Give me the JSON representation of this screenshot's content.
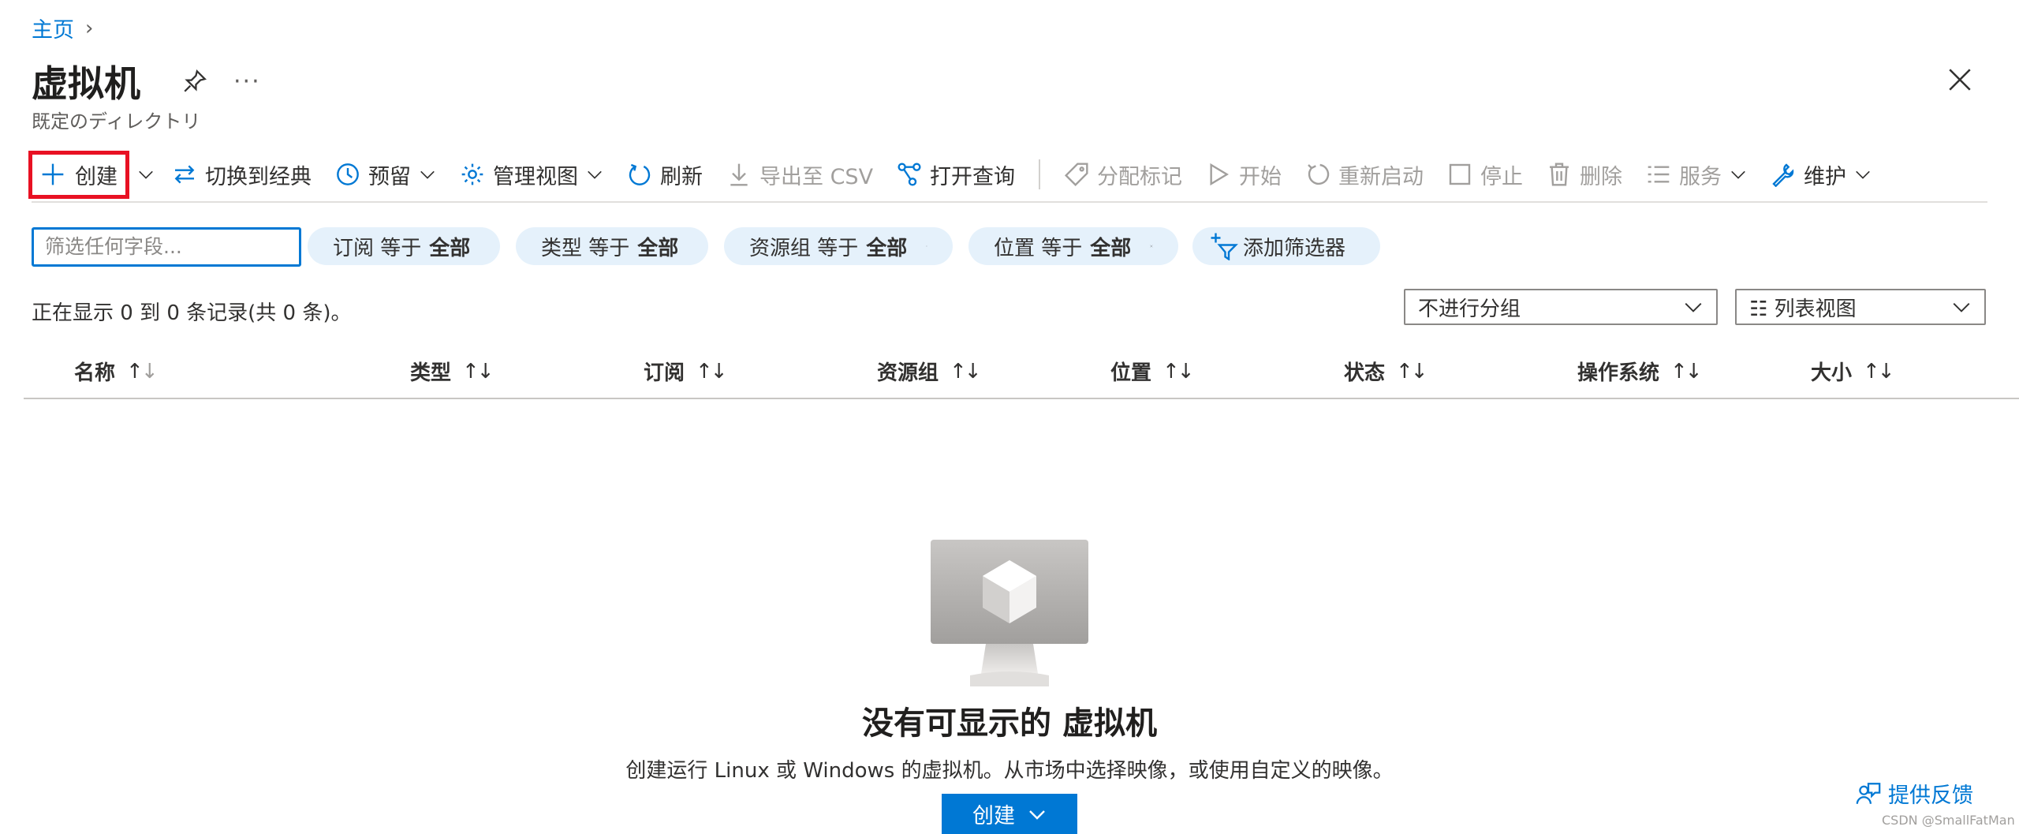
{
  "breadcrumb": {
    "home": "主页"
  },
  "header": {
    "title": "虚拟机",
    "subtitle": "既定のディレクトリ",
    "more": "···"
  },
  "toolbar": {
    "create": "创建",
    "switch_classic": "切换到经典",
    "reserve": "预留",
    "manage_view": "管理视图",
    "refresh": "刷新",
    "export_csv": "导出至 CSV",
    "open_query": "打开查询",
    "assign_tags": "分配标记",
    "start": "开始",
    "restart": "重新启动",
    "stop": "停止",
    "delete": "删除",
    "services": "服务",
    "maintain": "维护"
  },
  "filters": {
    "search_placeholder": "筛选任何字段...",
    "pills": [
      {
        "label": "订阅 等于",
        "value": "全部"
      },
      {
        "label": "类型 等于",
        "value": "全部"
      },
      {
        "label": "资源组 等于",
        "value": "全部"
      },
      {
        "label": "位置 等于",
        "value": "全部"
      }
    ],
    "add_filter": "添加筛选器"
  },
  "records": {
    "count_text": "正在显示 0 到 0 条记录(共 0 条)。",
    "group_select": "不进行分组",
    "view_select": "☷ 列表视图"
  },
  "table": {
    "columns": [
      "名称",
      "类型",
      "订阅",
      "资源组",
      "位置",
      "状态",
      "操作系统",
      "大小"
    ]
  },
  "empty": {
    "title": "没有可显示的 虚拟机",
    "description": "创建运行 Linux 或 Windows 的虚拟机。从市场中选择映像，或使用自定义的映像。",
    "create_button": "创建"
  },
  "footer": {
    "feedback": "提供反馈",
    "watermark": "CSDN @SmallFatMan"
  },
  "colors": {
    "accent": "#0078d4",
    "highlight": "#e81123",
    "pill_bg": "#e5f1fb"
  }
}
